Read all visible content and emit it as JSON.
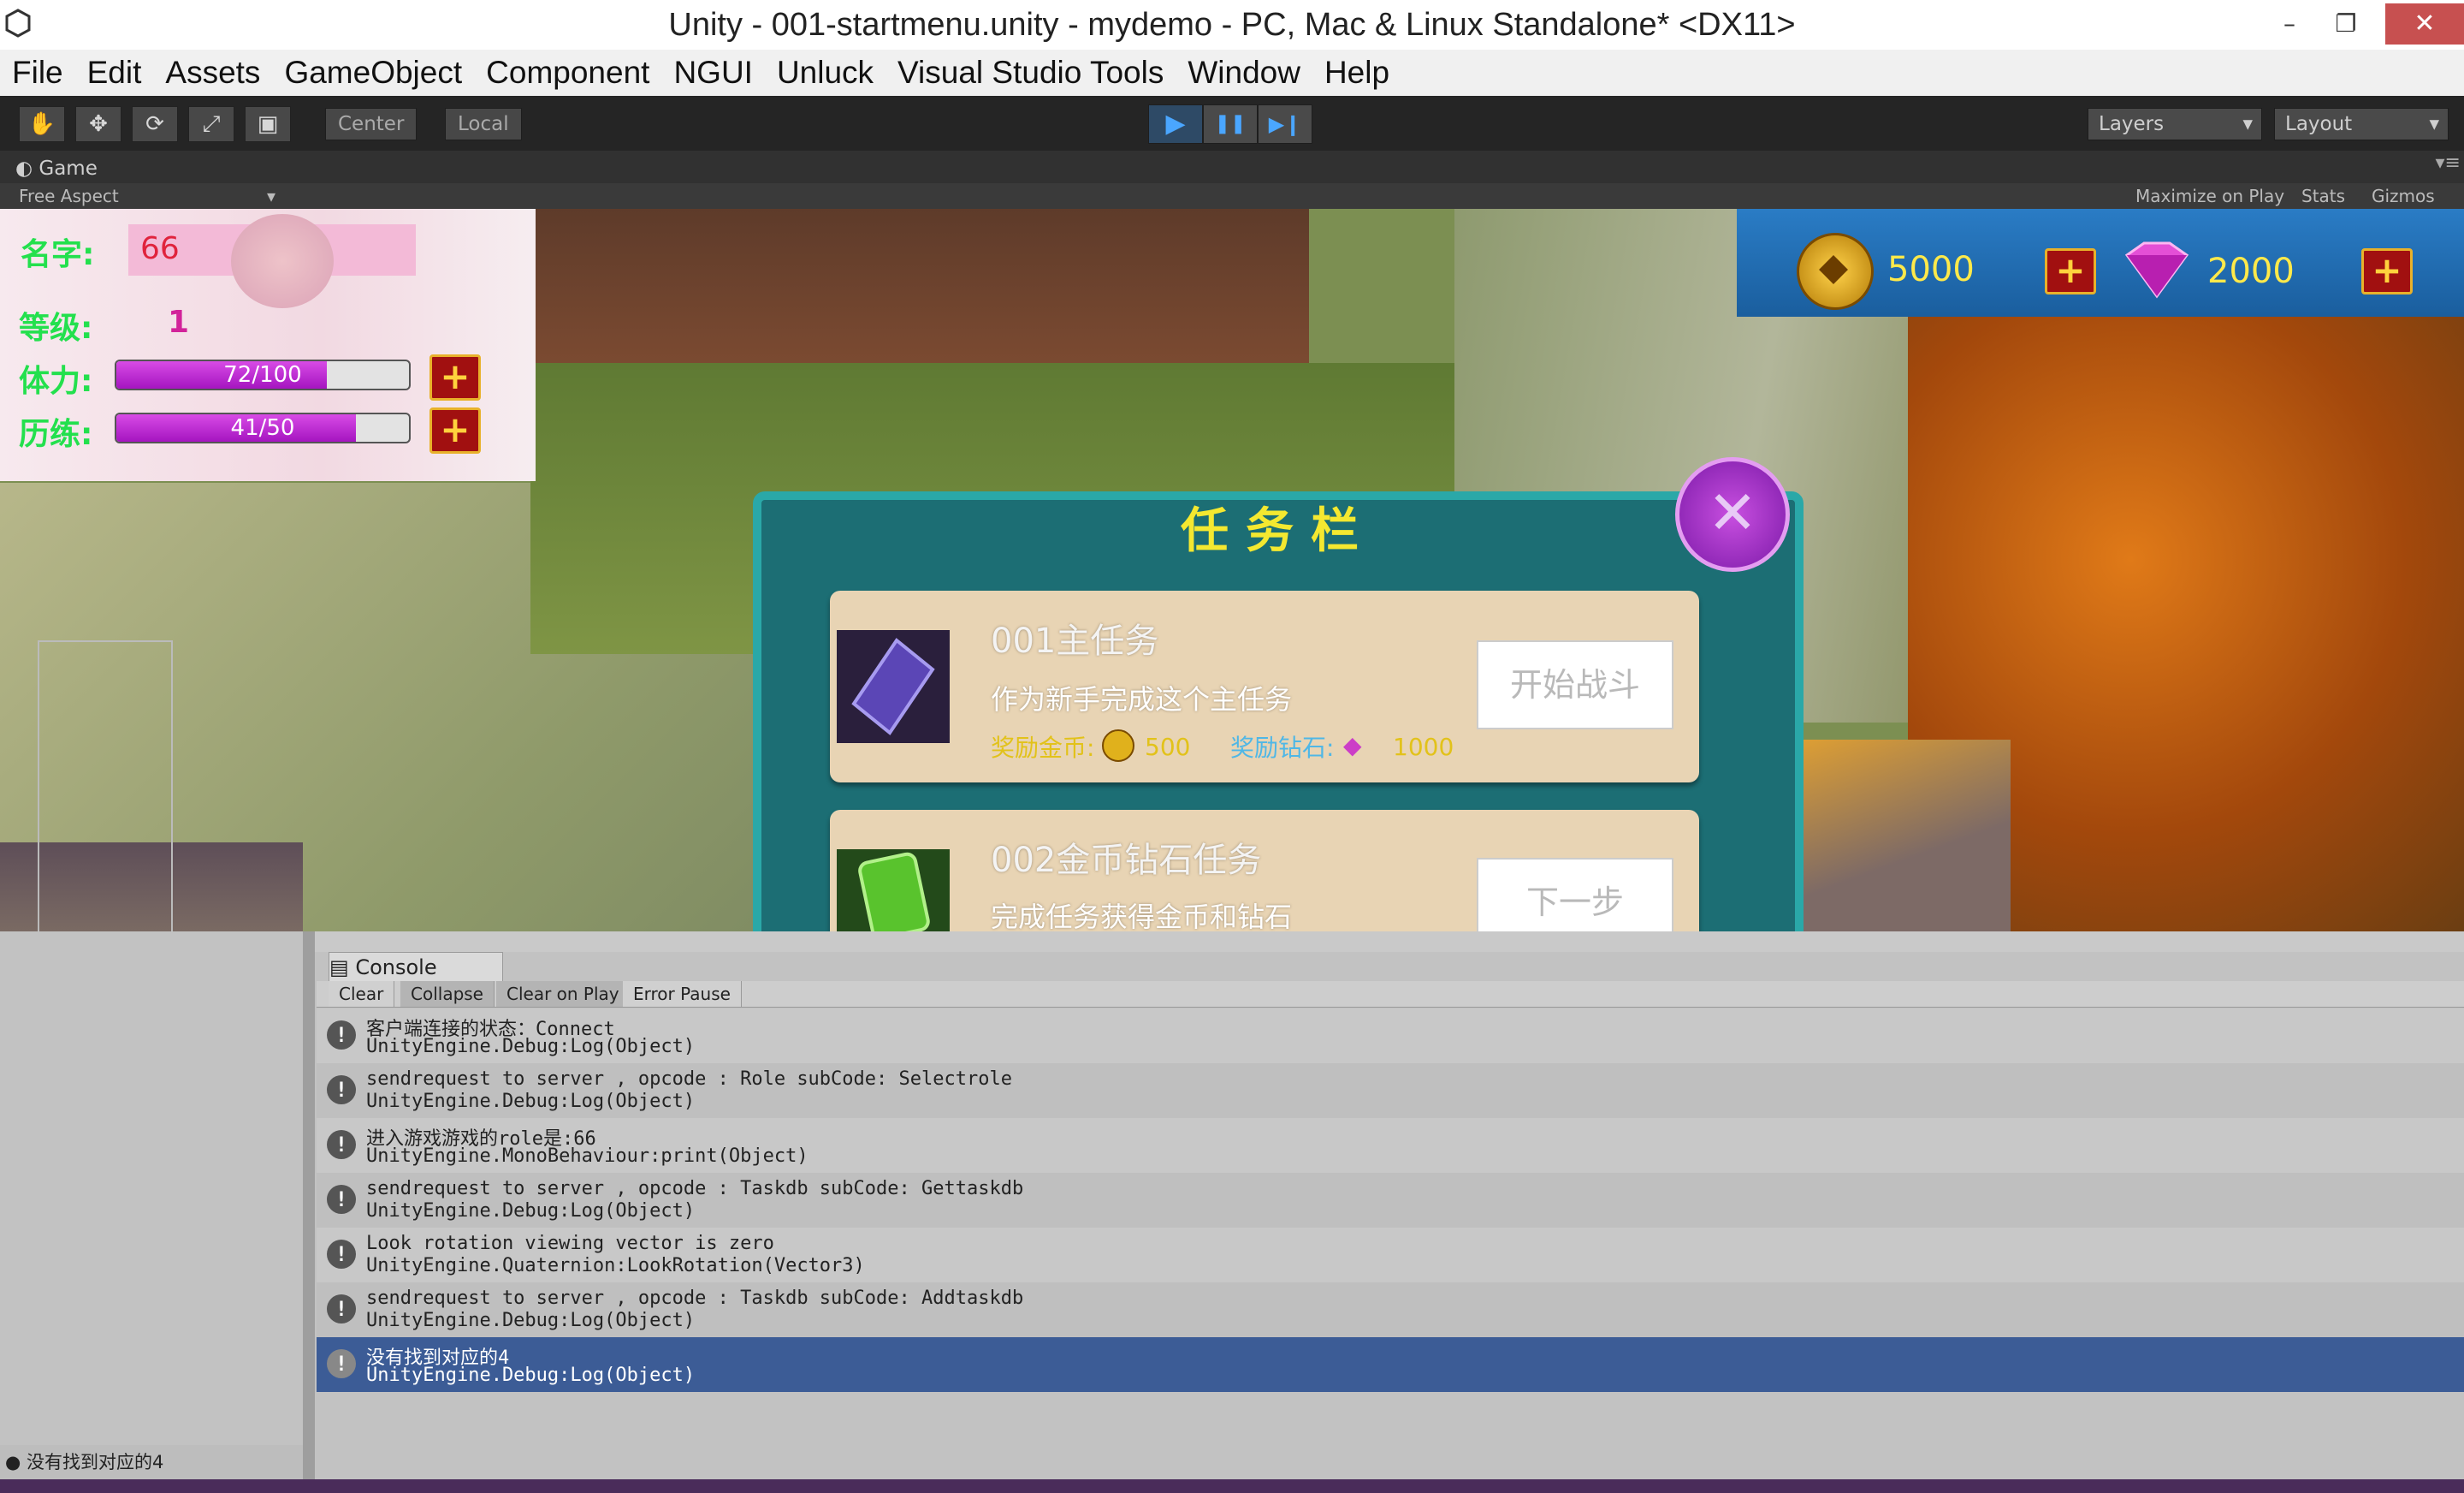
{
  "window": {
    "title": "Unity - 001-startmenu.unity - mydemo - PC, Mac & Linux Standalone* <DX11>",
    "minimize": "–",
    "maximize": "❐",
    "close": "✕"
  },
  "menu": [
    "File",
    "Edit",
    "Assets",
    "GameObject",
    "Component",
    "NGUI",
    "Unluck",
    "Visual Studio Tools",
    "Window",
    "Help"
  ],
  "toolbar": {
    "tools": [
      "hand-icon",
      "move-icon",
      "rotate-icon",
      "scale-icon",
      "rect-icon"
    ],
    "pivot_center": "Center",
    "pivot_local": "Local",
    "play": "▶",
    "pause": "❚❚",
    "step": "▶❙",
    "layers": "Layers",
    "layout": "Layout"
  },
  "game_panel": {
    "tab": "Game",
    "aspect": "Free Aspect",
    "maximize": "Maximize on Play",
    "stats": "Stats",
    "gizmos": "Gizmos"
  },
  "hud": {
    "name_label": "名字:",
    "name_value": "66",
    "level_label": "等级:",
    "level_value": "1",
    "stamina_label": "体力:",
    "stamina_text": "72/100",
    "stamina_fraction": 0.72,
    "exp_label": "历练:",
    "exp_text": "41/50",
    "exp_fraction": 0.82,
    "plus": "+",
    "coins": "5000",
    "diamonds": "2000"
  },
  "quest": {
    "title": "任务栏",
    "close": "✕",
    "items": [
      {
        "name": "001主任务",
        "desc": "作为新手完成这个主任务",
        "gold_label": "奖励金币:",
        "gold": "500",
        "diamond_label": "奖励钻石:",
        "diamond": "1000",
        "button": "开始战斗"
      },
      {
        "name": "002金币钻石任务",
        "desc": "完成任务获得金币和钻石",
        "button": "下一步"
      }
    ]
  },
  "console": {
    "tab": "Console",
    "buttons": [
      "Clear",
      "Collapse",
      "Clear on Play",
      "Error Pause"
    ],
    "logs": [
      {
        "line1": "客户端连接的状态：Connect",
        "line2": "UnityEngine.Debug:Log(Object)"
      },
      {
        "line1": "sendrequest to server , opcode : Role subCode:  Selectrole",
        "line2": "UnityEngine.Debug:Log(Object)"
      },
      {
        "line1": "进入游戏游戏的role是:66",
        "line2": "UnityEngine.MonoBehaviour:print(Object)"
      },
      {
        "line1": "sendrequest to server , opcode : Taskdb subCode:  Gettaskdb",
        "line2": "UnityEngine.Debug:Log(Object)"
      },
      {
        "line1": "Look rotation viewing vector is zero",
        "line2": "UnityEngine.Quaternion:LookRotation(Vector3)"
      },
      {
        "line1": "sendrequest to server , opcode : Taskdb subCode:  Addtaskdb",
        "line2": "UnityEngine.Debug:Log(Object)"
      },
      {
        "line1": "没有找到对应的4",
        "line2": "UnityEngine.Debug:Log(Object)"
      }
    ],
    "selected_index": 6
  },
  "status_bar": "没有找到对应的4",
  "colors": {
    "play_blue": "#4aa6ff",
    "hud_green": "#23e04d",
    "selected_row": "#3c5c96"
  }
}
